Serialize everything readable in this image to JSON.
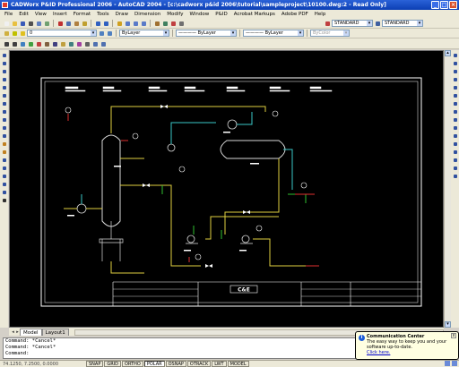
{
  "window": {
    "title": "CADWorx P&ID Professional 2006 - AutoCAD 2004 - [c:\\cadworx p&id 2006\\tutorial\\sampleproject\\10100.dwg:2 - Read Only]",
    "minimize": "_",
    "maximize": "□",
    "close": "×"
  },
  "menu": {
    "items": [
      "File",
      "Edit",
      "View",
      "Insert",
      "Format",
      "Tools",
      "Draw",
      "Dimension",
      "Modify",
      "Window",
      "P&ID",
      "Acrobat Markups",
      "Adobe PDF",
      "Help"
    ]
  },
  "toolbars": {
    "layer_value": "0",
    "color_value": "ByLayer",
    "linetype_value": "———— ByLayer",
    "lineweight_value": "———— ByLayer",
    "plotstyle_value": "ByColor",
    "text_style": "STANDARD",
    "dim_style": "STANDARD"
  },
  "drawing": {
    "title_block_logo": "C&E"
  },
  "tabs": {
    "items": [
      "Model",
      "Layout1"
    ],
    "active": "Model",
    "nav": [
      "◂",
      "▸"
    ]
  },
  "command_line": {
    "lines": [
      "Command: *Cancel*",
      "Command: *Cancel*",
      "Command:"
    ]
  },
  "notification": {
    "title": "Communication Center",
    "message": "The easy way to keep you and your software up-to-date.",
    "link": "Click here.",
    "close": "x",
    "icon": "info-icon"
  },
  "statusbar": {
    "coordinates": "74.1250, 7.2500, 0.0000",
    "modes": [
      {
        "label": "SNAP",
        "on": false
      },
      {
        "label": "GRID",
        "on": false
      },
      {
        "label": "ORTHO",
        "on": false
      },
      {
        "label": "POLAR",
        "on": true
      },
      {
        "label": "OSNAP",
        "on": false
      },
      {
        "label": "OTRACK",
        "on": false
      },
      {
        "label": "LWT",
        "on": false
      },
      {
        "label": "MODEL",
        "on": false
      }
    ]
  },
  "colors": {
    "canvas": "#000000",
    "pipe_yellow": "#e0d040",
    "pipe_cyan": "#3ac8c8",
    "pipe_green": "#30c030",
    "pipe_red": "#e03030",
    "border_white": "#ffffff"
  }
}
